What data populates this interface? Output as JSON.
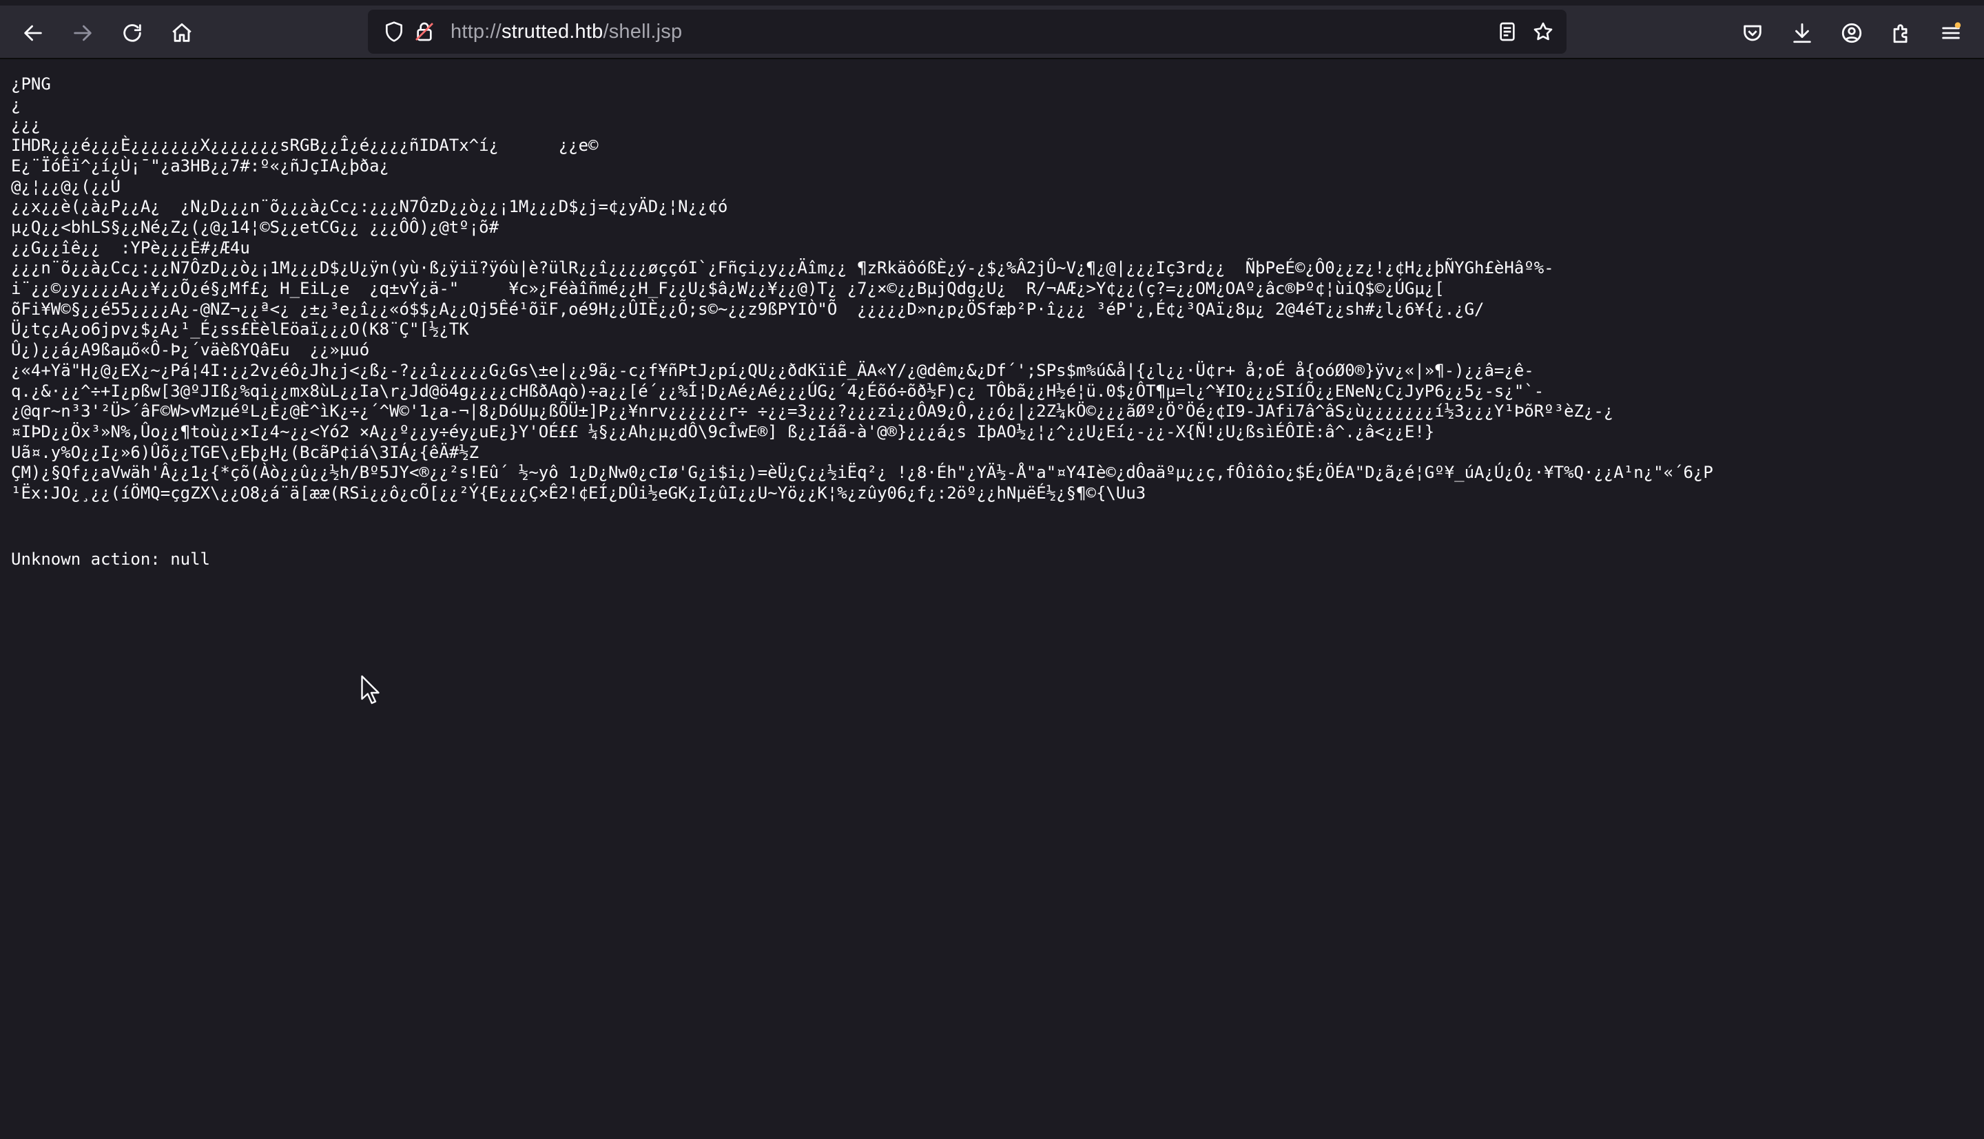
{
  "browser": {
    "url_scheme": "http://",
    "url_host": "strutted.htb",
    "url_path": "/shell.jsp",
    "icons": [
      "back-icon",
      "forward-icon",
      "reload-icon",
      "home-icon",
      "shield-icon",
      "lock-icon",
      "reader-view-icon",
      "bookmark-star-icon",
      "pocket-icon",
      "download-icon",
      "account-icon",
      "extensions-icon",
      "menu-icon"
    ],
    "accent": "#ffbd4f"
  },
  "page": {
    "binary_lines": [
      "¿PNG",
      "¿",
      "¿¿¿",
      "IHDR¿¿¿é¿¿¿È¿¿¿¿¿¿¿X¿¿¿¿¿¿¿sRGB¿¿Î¿é¿¿¿¿ñIDATx^í¿      ¿¿e©",
      "E¿¨ÏóÊï^¿í¿Ù¡¯\"¿a3HB¿¿7#:º«¿ñJçIA¿þða¿",
      "@¿¦¿¿@¿(¿¿Ú",
      "¿¿x¿¿è(¿à¿P¿¿A¿  ¿N¿D¿¿¿n¨õ¿¿¿à¿Cc¿:¿¿¿N7ÔzD¿¿ò¿¿¡1M¿¿¿D$¿j=¢¿yÄD¿¦N¿¿¢ó",
      "µ¿Q¿¿<bhLS§¿¿Né¿Z¿(¿@¿14¦©S¿¿etCG¿¿ ¿¿¿ÔÔ)¿@tº¡õ#",
      "¿¿G¿¿îê¿¿  :YPè¿¿¿È#¿Æ4u",
      "¿¿¿n¨õ¿¿à¿Cc¿:¿¿N7ÔzD¿¿ò¿¡1M¿¿¿D$¿U¿ÿn(yù·ß¿ÿiï?ÿóù|è?ülR¿¿î¿¿¿¿øççóI`¿Fñçi¿y¿¿Äîm¿¿ ¶zRkäôóßÈ¿ý-¿$¿%Â2jÛ~V¿¶¿@|¿¿¿Iç3rd¿¿  ÑþPeÉ©¿Ô0¿¿z¿!¿¢H¿¿þÑYGh£èHâº%-",
      "i¨¿¿©¿y¿¿¿¿A¿¿¥¿¿Õ¿é§¿Mf£¿ H_EiL¿e  ¿q±vÝ¿ä-\"     ¥c»¿Féàîñmé¿¿H_F¿¿U¿$â¿W¿¿¥¿¿@)T¿ ¿7¿×©¿¿BµjQdg¿U¿  R/¬AÆ¿>Y¢¿¿(ç?=¿¿OM¿OAº¿âc®Þº¢¦ùiQ$©¿ÚGµ¿[",
      "õFi¥W©§¿¿é55¿¿¿¿A¿-@NZ¬¿¿ª<¿ ¿±¿³e¿î¿¿«ó$$¿A¿¿Qj5Êé¹õïF,oé9H¿¿ÛIÈ¿¿Õ;s©~¿¿z9ßPYIÒ\"Õ  ¿¿¿¿¿D»n¿p¿ÖSfæþ²P·î¿¿¿ ³éP'¿,É¢¿³QAï¿8µ¿ 2@4éT¿¿sh#¿l¿6¥{¿.¿G/",
      "Ü¿tç¿A¿o6jpv¿$¿A¿¹_É¿ss£ÈèlEöaï¿¿¿O(K8¨Ç\"[½¿TK",
      "Û¿)¿¿á¿A9ßaµõ«Ô-Þ¿´väèßYQâEu  ¿¿»µuó",
      "¿«4+Yä\"H¿@¿EX¿~¿Pá¦4I:¿¿2v¿éô¿Jh¿j<¿ß¿-?¿¿î¿¿¿¿¿G¿Gs\\±e|¿¿9ã¿-c¿f¥ñPtJ¿pí¿QU¿¿ðdKïiÊ_ÄA«Y/¿@dêm¿&¿Df´';SPs$m%ú&å|{¿l¿¿·Ü¢r+ å;oÉ å{oóØ0®}ÿv¿«|»¶-)¿¿â=¿ê-",
      "q.¿&·¿¿^÷+I¿pßw[3@ºJIß¿%qi¿¿mx8ùL¿¿Ia\\r¿Jd@ö4g¿¿¿¿cHßðAqò)÷a¿¿[é´¿¿%Í¦D¿Aé¿Aé¿¿¿ÚG¿´4¿Éõó÷õð½F)c¿ TÔbã¿¿H½é¦ü.0$¿ÔT¶µ=l¿^¥IO¿¿¿SIíÕ¿¿ENeN¿C¿JyP6¿¿5¿-s¿\"`-",
      "¿@qr~n³3'²Ü>´âF©W>vMzµéºL¿È¿@È^ìK¿÷¿´^W©'1¿a-¬|8¿DóUµ¿ßÕÜ±]P¿¿¥nrv¿¿¿¿¿¿r÷ ÷¿¿=3¿¿¿?¿¿¿zi¿¿ÔA9¿Ô,¿¿ó¿|¿2Z¼kÖ©¿¿¿ãØº¿Ö°Öé¿¢I9-JAfi7â^âS¿ù¿¿¿¿¿¿¿í½3¿¿¿Y¹ÞõRº³èZ¿-¿",
      "¤IÞD¿¿Öx³»N%,Ûo¿¿¶toù¿¿×I¿4~¿¿<Yó2 ×A¿¿º¿¿y÷éy¿uE¿}Y'OÉ££ ¼§¿¿Ah¿µ¿dÔ\\9cÎwE®] ß¿¿Iáã-à'@®}¿¿¿á¿s IþAO½¿¦¿^¿¿U¿Eí¿-¿¿-X{Ñ!¿U¿ßsìÉÔIÈ:â^.¿â<¿¿E!}",
      "Uã¤.y%O¿¿I¿»6)Ûõ¿¿TGE\\¿Eþ¿H¿(BcãP¢iá\\3IÁ¿{êÄ#½Z",
      "ÇM)¿§Qf¿¿aVwäh'Â¿¿1¿{*çõ(Àò¿¿û¿¿½h/Bº5JY<®¿¿²s!Eû´ ½~yô 1¿D¿Nw0¿cIø'G¿i$i¿)=èÜ¿Ç¿¿½iËq²¿ !¿8·Éh\"¿YÄ½-Å\"a\"¤Y4Iè©¿dÔaäºµ¿¿ç,fÔîôîo¿$É¿ÖÉA\"D¿ã¿é¦Gº¥_úA¿Ú¿Ó¿·¥T%Q·¿¿A¹n¿\"«´6¿P",
      "¹Ëx:JO¿¸¿¿(íÖMQ=çgZX\\¿¿O8¿á¨ä[ææ(RSi¿¿ô¿cÕ[¿¿²Ý{E¿¿¿Ç×Ê2!¢EÍ¿DÛi½eGK¿I¿ûI¿¿U~Yö¿¿K¦%¿zûy06¿f¿:2öº¿¿hNµëÉ½¿§¶©{\\Uu3"
    ],
    "status_line": "Unknown action: null"
  }
}
